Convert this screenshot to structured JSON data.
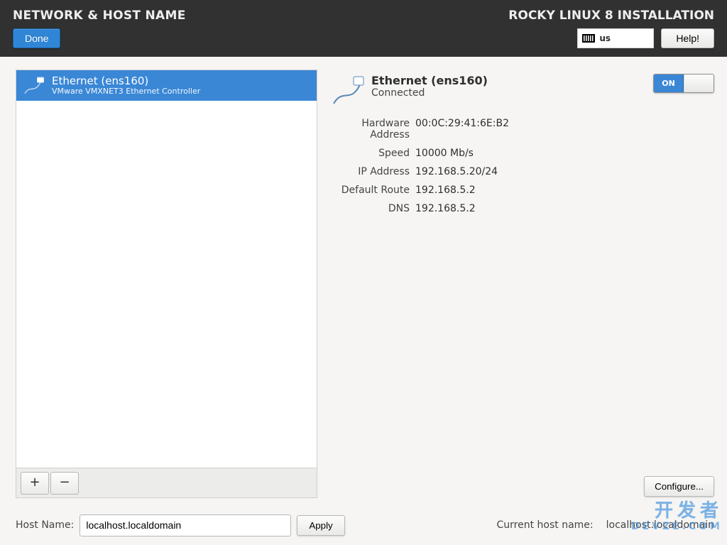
{
  "header": {
    "page_title": "NETWORK & HOST NAME",
    "installer_title": "ROCKY LINUX 8 INSTALLATION",
    "done_label": "Done",
    "help_label": "Help!",
    "keyboard_layout": "us"
  },
  "device_list": {
    "items": [
      {
        "name": "Ethernet (ens160)",
        "description": "VMware VMXNET3 Ethernet Controller"
      }
    ],
    "add_symbol": "+",
    "remove_symbol": "−"
  },
  "details": {
    "name": "Ethernet (ens160)",
    "status": "Connected",
    "toggle_state": "ON",
    "rows": {
      "hw_label": "Hardware Address",
      "hw_value": "00:0C:29:41:6E:B2",
      "speed_label": "Speed",
      "speed_value": "10000 Mb/s",
      "ip_label": "IP Address",
      "ip_value": "192.168.5.20/24",
      "route_label": "Default Route",
      "route_value": "192.168.5.2",
      "dns_label": "DNS",
      "dns_value": "192.168.5.2"
    },
    "configure_label": "Configure..."
  },
  "hostname": {
    "label": "Host Name:",
    "value": "localhost.localdomain",
    "apply_label": "Apply",
    "current_label": "Current host name:",
    "current_value": "localhost.localdomain"
  },
  "watermark": {
    "zh": "开发者",
    "en": "DEVZE.COM"
  }
}
